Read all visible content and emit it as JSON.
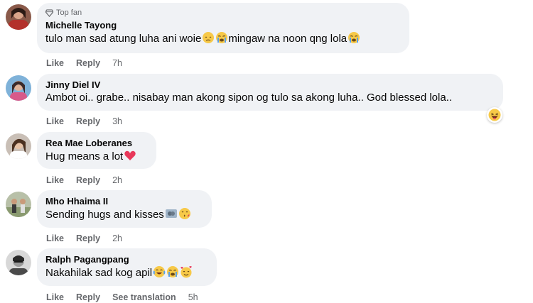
{
  "comments": [
    {
      "badge": "Top fan",
      "author": "Michelle Tayong",
      "text": "tulo man sad atung luha ani woie",
      "text2": "mingaw na noon qng lola",
      "actions": [
        "Like",
        "Reply"
      ],
      "time": "7h"
    },
    {
      "author": "Jinny Diel IV",
      "text": "Ambot oi.. grabe.. nisabay man akong sipon og tulo sa akong luha.. God blessed lola..",
      "actions": [
        "Like",
        "Reply"
      ],
      "time": "3h"
    },
    {
      "author": "Rea Mae Loberanes",
      "text": "Hug means a lot",
      "actions": [
        "Like",
        "Reply"
      ],
      "time": "2h"
    },
    {
      "author": "Mho Hhaima II",
      "text": "Sending hugs and kisses",
      "actions": [
        "Like",
        "Reply"
      ],
      "time": "2h"
    },
    {
      "author": "Ralph Pagangpang",
      "text": "Nakahilak sad kog apil",
      "actions": [
        "Like",
        "Reply",
        "See translation"
      ],
      "time": "5h"
    }
  ],
  "colors": {
    "bubble": "#f0f2f5",
    "meta": "#65676b",
    "text": "#050505"
  },
  "icons": {
    "badge": "diamond-icon",
    "reaction": "haha-reaction-icon"
  }
}
